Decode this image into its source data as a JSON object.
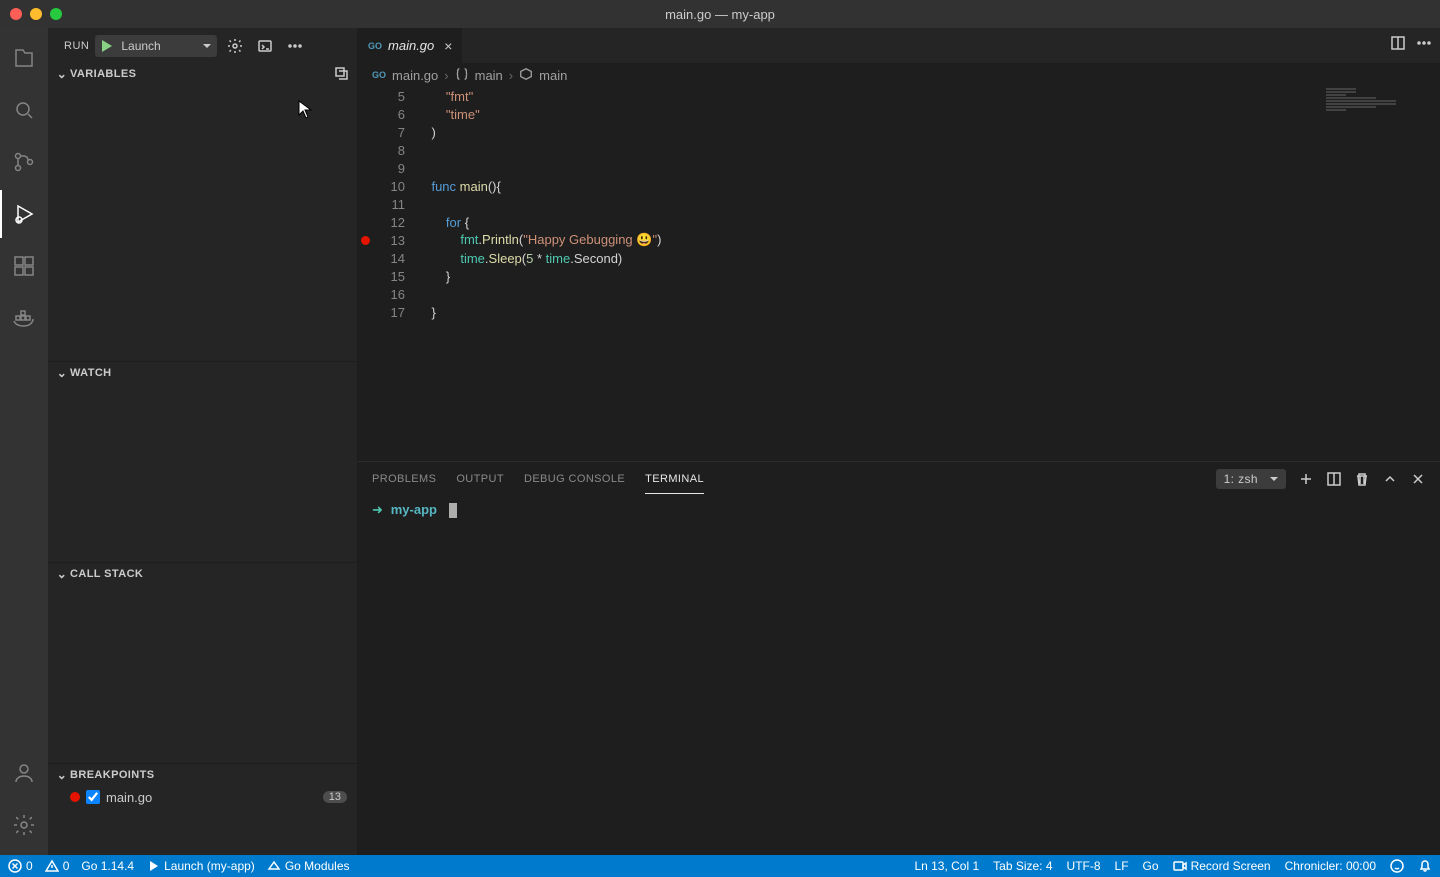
{
  "window": {
    "title": "main.go — my-app"
  },
  "run": {
    "label": "RUN",
    "config": "Launch"
  },
  "sidebar": {
    "variables": {
      "title": "VARIABLES"
    },
    "watch": {
      "title": "WATCH"
    },
    "callstack": {
      "title": "CALL STACK"
    },
    "breakpoints": {
      "title": "BREAKPOINTS",
      "items": [
        {
          "file": "main.go",
          "line": "13",
          "checked": true
        }
      ]
    }
  },
  "tab": {
    "file": "main.go"
  },
  "breadcrumbs": {
    "file": "main.go",
    "pkg": "main",
    "sym": "main"
  },
  "code": {
    "lines": [
      {
        "n": "5",
        "bp": false,
        "html": "        <span class='tok-str'>\"fmt\"</span>"
      },
      {
        "n": "6",
        "bp": false,
        "html": "        <span class='tok-str'>\"time\"</span>"
      },
      {
        "n": "7",
        "bp": false,
        "html": "    )"
      },
      {
        "n": "8",
        "bp": false,
        "html": ""
      },
      {
        "n": "9",
        "bp": false,
        "html": ""
      },
      {
        "n": "10",
        "bp": false,
        "html": "    <span class='tok-key'>func</span> <span class='tok-func'>main</span>(){"
      },
      {
        "n": "11",
        "bp": false,
        "html": ""
      },
      {
        "n": "12",
        "bp": false,
        "html": "        <span class='tok-key'>for</span> {"
      },
      {
        "n": "13",
        "bp": true,
        "html": "            <span class='tok-type'>fmt</span>.<span class='tok-func'>Println</span>(<span class='tok-str'>\"Happy Gebugging 😃\"</span>)"
      },
      {
        "n": "14",
        "bp": false,
        "html": "            <span class='tok-type'>time</span>.<span class='tok-func'>Sleep</span>(<span class='tok-num'>5</span> * <span class='tok-type'>time</span>.Second)"
      },
      {
        "n": "15",
        "bp": false,
        "html": "        }"
      },
      {
        "n": "16",
        "bp": false,
        "html": ""
      },
      {
        "n": "17",
        "bp": false,
        "html": "    }"
      }
    ]
  },
  "panel": {
    "tabs": {
      "problems": "PROBLEMS",
      "output": "OUTPUT",
      "debug": "DEBUG CONSOLE",
      "terminal": "TERMINAL"
    },
    "terminal_name": "1: zsh",
    "prompt_cwd": "my-app"
  },
  "status": {
    "errors": "0",
    "warnings": "0",
    "go_version": "Go 1.14.4",
    "launch": "Launch (my-app)",
    "go_modules": "Go Modules",
    "cursor": "Ln 13, Col 1",
    "tab_size": "Tab Size: 4",
    "encoding": "UTF-8",
    "eol": "LF",
    "lang": "Go",
    "record": "Record Screen",
    "chronicler": "Chronicler: 00:00"
  }
}
